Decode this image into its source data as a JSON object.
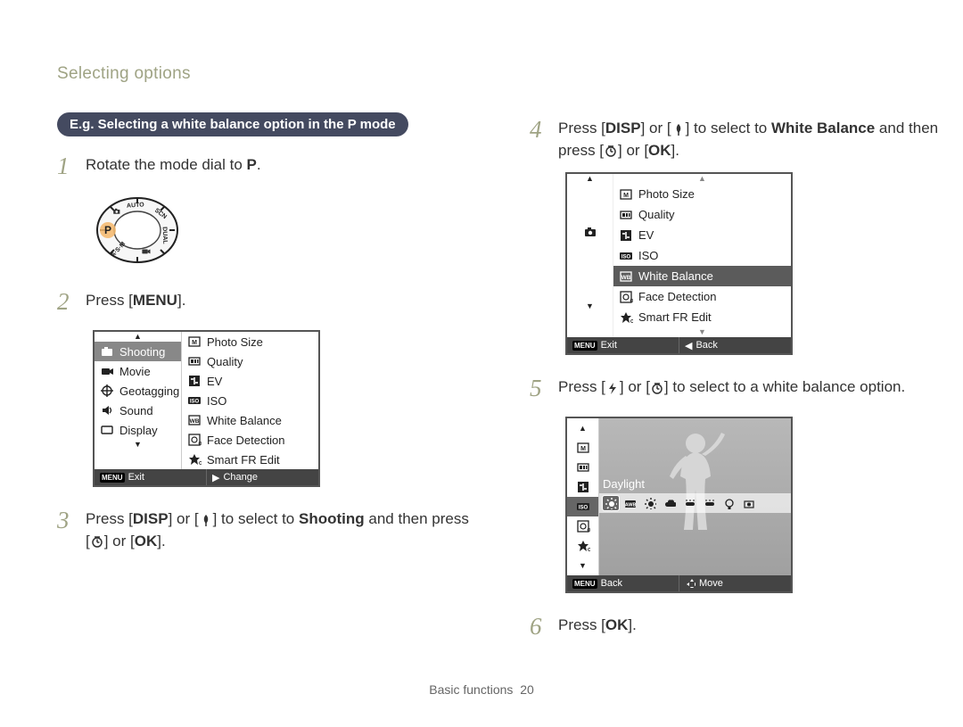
{
  "header": "Selecting options",
  "callout": "E.g. Selecting a white balance option in the P mode",
  "steps": {
    "s1": {
      "num": "1",
      "prefix": "Rotate the mode dial to ",
      "target": "P",
      "suffix": "."
    },
    "s2": {
      "num": "2",
      "prefix": "Press [",
      "btn": "MENU",
      "suffix": "]."
    },
    "s3": {
      "num": "3",
      "prefix": "Press [",
      "btn1": "DISP",
      "mid1": "] or [",
      "mid2": "] to select to ",
      "bold": "Shooting",
      "mid3": " and then press [",
      "mid4": "] or [",
      "btn2": "OK",
      "suffix": "]."
    },
    "s4": {
      "num": "4",
      "prefix": "Press [",
      "btn1": "DISP",
      "mid1": "] or [",
      "mid2": "] to select to ",
      "bold": "White Balance",
      "mid3": " and then press [",
      "mid4": "] or [",
      "btn2": "OK",
      "suffix": "]."
    },
    "s5": {
      "num": "5",
      "prefix": "Press [",
      "mid1": "] or [",
      "mid2": "] to select to a white balance option."
    },
    "s6": {
      "num": "6",
      "prefix": "Press [",
      "btn": "OK",
      "suffix": "]."
    }
  },
  "lcd1": {
    "leftTabs": [
      "Shooting",
      "Movie",
      "Geotagging",
      "Sound",
      "Display"
    ],
    "rightItems": [
      "Photo Size",
      "Quality",
      "EV",
      "ISO",
      "White Balance",
      "Face Detection",
      "Smart FR Edit"
    ],
    "footerLeft": "Exit",
    "footerLeftBadge": "MENU",
    "footerRight": "Change"
  },
  "lcd4": {
    "rightItems": [
      "Photo Size",
      "Quality",
      "EV",
      "ISO",
      "White Balance",
      "Face Detection",
      "Smart FR Edit"
    ],
    "selectedIndex": 4,
    "footerLeft": "Exit",
    "footerLeftBadge": "MENU",
    "footerRight": "Back"
  },
  "lcd5": {
    "label": "Daylight",
    "footerLeft": "Back",
    "footerLeftBadge": "MENU",
    "footerRight": "Move"
  },
  "footer": {
    "section": "Basic functions",
    "page": "20"
  }
}
